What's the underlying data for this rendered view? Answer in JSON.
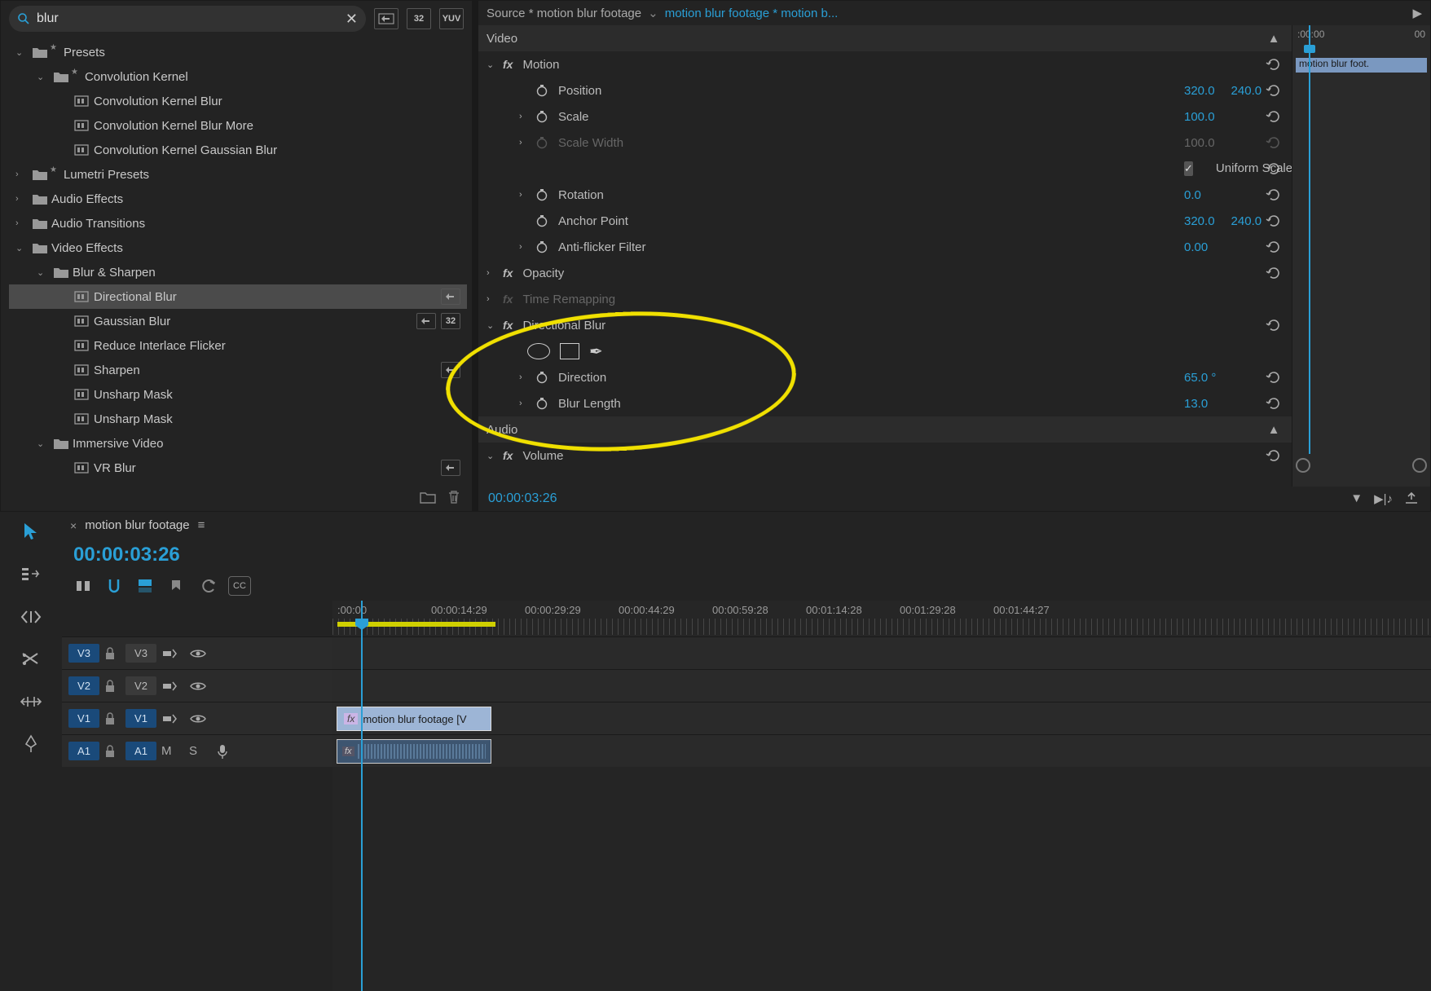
{
  "effects_panel": {
    "search_value": "blur",
    "toolbar_badges": [
      "▶≡",
      "32",
      "YUV"
    ],
    "tree": [
      {
        "level": 0,
        "expanded": true,
        "icon": "folder-star",
        "label": "Presets"
      },
      {
        "level": 1,
        "expanded": true,
        "icon": "folder-star",
        "label": "Convolution Kernel"
      },
      {
        "level": 2,
        "icon": "preset",
        "label": "Convolution Kernel Blur"
      },
      {
        "level": 2,
        "icon": "preset",
        "label": "Convolution Kernel Blur More"
      },
      {
        "level": 2,
        "icon": "preset",
        "label": "Convolution Kernel Gaussian Blur"
      },
      {
        "level": 0,
        "expanded": false,
        "icon": "folder-star",
        "label": "Lumetri Presets"
      },
      {
        "level": 0,
        "expanded": false,
        "icon": "folder",
        "label": "Audio Effects"
      },
      {
        "level": 0,
        "expanded": false,
        "icon": "folder",
        "label": "Audio Transitions"
      },
      {
        "level": 0,
        "expanded": true,
        "icon": "folder",
        "label": "Video Effects"
      },
      {
        "level": 1,
        "expanded": true,
        "icon": "folder",
        "label": "Blur & Sharpen"
      },
      {
        "level": 2,
        "icon": "preset",
        "label": "Directional Blur",
        "selected": true,
        "badges": [
          "accel"
        ]
      },
      {
        "level": 2,
        "icon": "preset",
        "label": "Gaussian Blur",
        "badges": [
          "accel",
          "32"
        ]
      },
      {
        "level": 2,
        "icon": "preset",
        "label": "Reduce Interlace Flicker"
      },
      {
        "level": 2,
        "icon": "preset",
        "label": "Sharpen",
        "badges": [
          "accel"
        ]
      },
      {
        "level": 2,
        "icon": "preset",
        "label": "Unsharp Mask"
      },
      {
        "level": 2,
        "icon": "preset",
        "label": "Unsharp Mask"
      },
      {
        "level": 1,
        "expanded": true,
        "icon": "folder",
        "label": "Immersive Video"
      },
      {
        "level": 2,
        "icon": "preset",
        "label": "VR Blur",
        "badges": [
          "accel"
        ]
      }
    ]
  },
  "effect_controls": {
    "source_label": "Source * motion blur footage",
    "sequence_label": "motion blur footage * motion b...",
    "video_header": "Video",
    "audio_header": "Audio",
    "current_time": "00:00:03:26",
    "mini_ruler": [
      ":00:00",
      "00"
    ],
    "mini_clip_label": "motion blur foot.",
    "effects": [
      {
        "type": "group",
        "label": "Motion",
        "fx": true,
        "expanded": true,
        "reset": true
      },
      {
        "type": "prop",
        "label": "Position",
        "vals": [
          "320.0",
          "240.0"
        ],
        "indent": 2,
        "reset": true
      },
      {
        "type": "prop",
        "label": "Scale",
        "vals": [
          "100.0"
        ],
        "indent": 2,
        "expander": true,
        "reset": true
      },
      {
        "type": "prop",
        "label": "Scale Width",
        "vals": [
          "100.0"
        ],
        "indent": 2,
        "dim": true,
        "expander": true,
        "reset": true
      },
      {
        "type": "check",
        "label": "Uniform Scale",
        "checked": true,
        "indent": 2,
        "reset": true
      },
      {
        "type": "prop",
        "label": "Rotation",
        "vals": [
          "0.0"
        ],
        "indent": 2,
        "expander": true,
        "reset": true
      },
      {
        "type": "prop",
        "label": "Anchor Point",
        "vals": [
          "320.0",
          "240.0"
        ],
        "indent": 2,
        "reset": true
      },
      {
        "type": "prop",
        "label": "Anti-flicker Filter",
        "vals": [
          "0.00"
        ],
        "indent": 2,
        "expander": true,
        "reset": true
      },
      {
        "type": "group",
        "label": "Opacity",
        "fx": true,
        "expanded": false,
        "reset": true
      },
      {
        "type": "group",
        "label": "Time Remapping",
        "fx": true,
        "dim": true,
        "expanded": false
      },
      {
        "type": "group",
        "label": "Directional Blur",
        "fx": true,
        "expanded": true,
        "reset": true
      },
      {
        "type": "masks",
        "indent": 2
      },
      {
        "type": "prop",
        "label": "Direction",
        "vals": [
          "65.0 °"
        ],
        "indent": 2,
        "expander": true,
        "reset": true
      },
      {
        "type": "prop",
        "label": "Blur Length",
        "vals": [
          "13.0"
        ],
        "indent": 2,
        "expander": true,
        "reset": true
      },
      {
        "type": "spacer"
      },
      {
        "type": "group",
        "label": "Volume",
        "fx": true,
        "expanded": true,
        "reset": true
      }
    ]
  },
  "timeline": {
    "sequence_name": "motion blur footage",
    "current_time": "00:00:03:26",
    "ruler_ticks": [
      ":00:00",
      "00:00:14:29",
      "00:00:29:29",
      "00:00:44:29",
      "00:00:59:28",
      "00:01:14:28",
      "00:01:29:28",
      "00:01:44:27"
    ],
    "tracks": [
      {
        "id": "V3",
        "src": "V3",
        "type": "v"
      },
      {
        "id": "V2",
        "src": "V2",
        "type": "v"
      },
      {
        "id": "V1",
        "src": "V1",
        "type": "v",
        "clip": "motion blur footage [V"
      },
      {
        "id": "A1",
        "src": "A1",
        "type": "a",
        "clip": "audio"
      }
    ]
  }
}
